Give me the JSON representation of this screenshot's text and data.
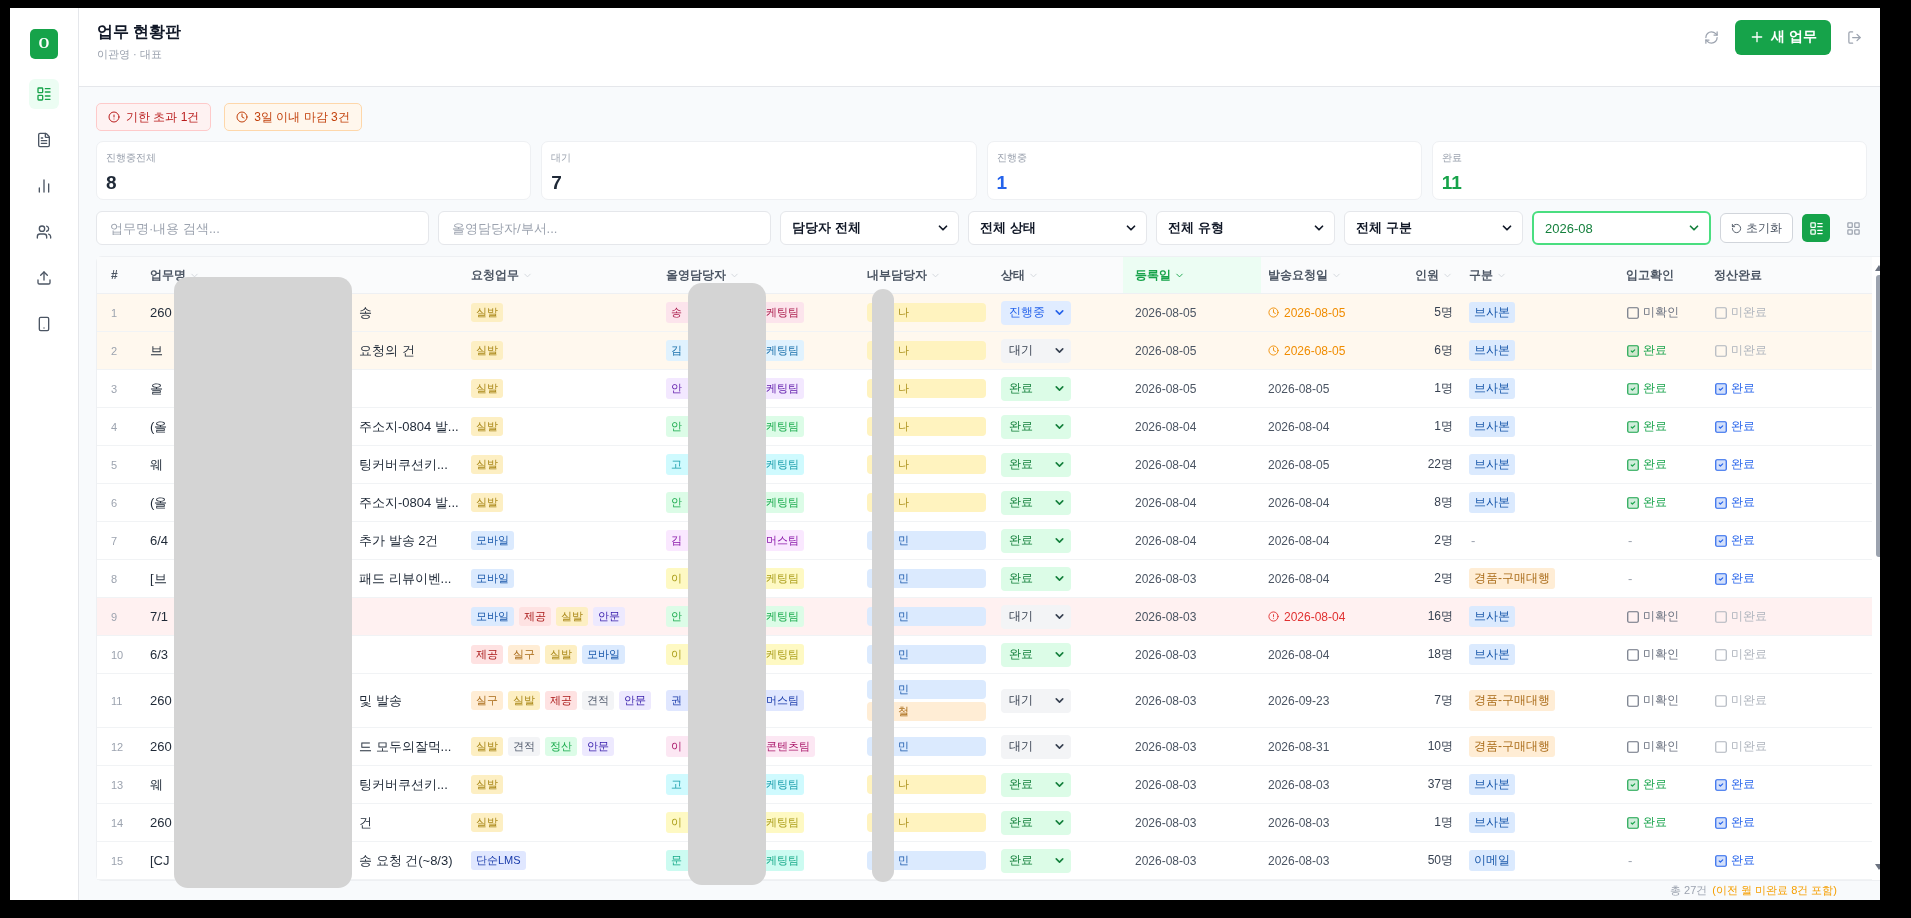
{
  "sidebar": {
    "logo": "O",
    "items": [
      {
        "kind": "list",
        "selected": true
      },
      {
        "kind": "document",
        "selected": false
      },
      {
        "kind": "chart",
        "selected": false
      },
      {
        "kind": "users",
        "selected": false
      },
      {
        "kind": "upload",
        "selected": false
      },
      {
        "kind": "phone",
        "selected": false
      }
    ]
  },
  "header": {
    "title": "업무 현황판",
    "subtitle": "이관영 · 대표",
    "new_button": "새 업무"
  },
  "alerts": [
    {
      "label": "기한 초과 1건",
      "kind": "overdue"
    },
    {
      "label": "3일 이내 마감 3건",
      "kind": "due_soon"
    }
  ],
  "stats": [
    {
      "label": "진행중전체",
      "value": "8",
      "color": "#1f2937"
    },
    {
      "label": "대기",
      "value": "7",
      "color": "#1f2937"
    },
    {
      "label": "진행중",
      "value": "1",
      "color": "#2563eb"
    },
    {
      "label": "완료",
      "value": "11",
      "color": "#16a34a"
    }
  ],
  "filters": {
    "searches": [
      {
        "placeholder": "업무명·내용 검색..."
      },
      {
        "placeholder": "올영담당자/부서..."
      }
    ],
    "selects": [
      {
        "value": "담당자 전체",
        "active": false
      },
      {
        "value": "전체 상태",
        "active": false
      },
      {
        "value": "전체 유형",
        "active": false
      },
      {
        "value": "전체 구분",
        "active": false
      },
      {
        "value": "2026-08",
        "active": true
      }
    ],
    "reset": "초기화",
    "views": [
      {
        "kind": "list",
        "selected": true
      },
      {
        "kind": "grid",
        "selected": false
      }
    ]
  },
  "table": {
    "columns": [
      {
        "label": "#",
        "sortable": false,
        "sorted": false
      },
      {
        "label": "업무명",
        "sortable": true,
        "sorted": false
      },
      {
        "label": "요청업무",
        "sortable": true,
        "sorted": false
      },
      {
        "label": "올영담당자",
        "sortable": true,
        "sorted": false
      },
      {
        "label": "내부담당자",
        "sortable": true,
        "sorted": false
      },
      {
        "label": "상태",
        "sortable": true,
        "sorted": false
      },
      {
        "label": "등록일",
        "sortable": true,
        "sorted": true
      },
      {
        "label": "발송요청일",
        "sortable": true,
        "sorted": false
      },
      {
        "label": "인원",
        "sortable": true,
        "sorted": false
      },
      {
        "label": "구분",
        "sortable": true,
        "sorted": false
      },
      {
        "label": "입고확인",
        "sortable": false,
        "sorted": false
      },
      {
        "label": "정산완료",
        "sortable": false,
        "sorted": false
      }
    ],
    "rows": [
      {
        "number": "1",
        "overdue": false,
        "due_soon": true,
        "name_head": "260",
        "name_tail": "송",
        "tasks": [
          {
            "label": "실발",
            "color": "#fdefc3"
          }
        ],
        "manager": {
          "head": "송",
          "tail": "케팅팀",
          "color": "#fce4ec"
        },
        "assignees": [
          {
            "label": "나",
            "color": "#fff3bf"
          }
        ],
        "status": {
          "label": "진행중",
          "kind": "progress"
        },
        "registered": "2026-08-05",
        "send_date": "2026-08-05",
        "people": "5명",
        "category": {
          "label": "브사본",
          "color": "#dbeafe"
        },
        "stock": {
          "kind": "check",
          "label": "미확인",
          "checked": false,
          "disabled": false
        },
        "settle": {
          "kind": "check",
          "label": "미완료",
          "checked": false,
          "disabled": true
        }
      },
      {
        "number": "2",
        "overdue": false,
        "due_soon": true,
        "name_head": "브",
        "name_tail": "요청의 건",
        "tasks": [
          {
            "label": "실발",
            "color": "#fdefc3"
          }
        ],
        "manager": {
          "head": "김",
          "tail": "케팅팀",
          "color": "#e0f2fe"
        },
        "assignees": [
          {
            "label": "나",
            "color": "#fff3bf"
          }
        ],
        "status": {
          "label": "대기",
          "kind": "waiting"
        },
        "registered": "2026-08-05",
        "send_date": "2026-08-05",
        "people": "6명",
        "category": {
          "label": "브사본",
          "color": "#dbeafe"
        },
        "stock": {
          "kind": "check",
          "label": "완료",
          "checked": true,
          "disabled": false
        },
        "settle": {
          "kind": "check",
          "label": "미완료",
          "checked": false,
          "disabled": true
        }
      },
      {
        "number": "3",
        "overdue": false,
        "due_soon": false,
        "name_head": "올",
        "tasks": [
          {
            "label": "실발",
            "color": "#fdefc3"
          }
        ],
        "manager": {
          "head": "안",
          "tail": "케팅팀",
          "color": "#f3e8ff"
        },
        "assignees": [
          {
            "label": "나",
            "color": "#fff3bf"
          }
        ],
        "status": {
          "label": "완료",
          "kind": "done"
        },
        "registered": "2026-08-05",
        "send_date": "2026-08-05",
        "people": "1명",
        "category": {
          "label": "브사본",
          "color": "#dbeafe"
        },
        "stock": {
          "kind": "check",
          "label": "완료",
          "checked": true,
          "disabled": false
        },
        "settle": {
          "kind": "check",
          "label": "완료",
          "checked": true,
          "disabled": false
        }
      },
      {
        "number": "4",
        "overdue": false,
        "due_soon": false,
        "name_head": "(올",
        "name_tail": "주소지-0804 발...",
        "tasks": [
          {
            "label": "실발",
            "color": "#fdefc3"
          }
        ],
        "manager": {
          "head": "안",
          "tail": "케팅팀",
          "color": "#dcfce7"
        },
        "assignees": [
          {
            "label": "나",
            "color": "#fff3bf"
          }
        ],
        "status": {
          "label": "완료",
          "kind": "done"
        },
        "registered": "2026-08-04",
        "send_date": "2026-08-04",
        "people": "1명",
        "category": {
          "label": "브사본",
          "color": "#dbeafe"
        },
        "stock": {
          "kind": "check",
          "label": "완료",
          "checked": true,
          "disabled": false
        },
        "settle": {
          "kind": "check",
          "label": "완료",
          "checked": true,
          "disabled": false
        }
      },
      {
        "number": "5",
        "overdue": false,
        "due_soon": false,
        "name_head": "웨",
        "name_tail": "팅커버쿠션키...",
        "tasks": [
          {
            "label": "실발",
            "color": "#fdefc3"
          }
        ],
        "manager": {
          "head": "고",
          "tail": "케팅팀",
          "color": "#cffafe"
        },
        "assignees": [
          {
            "label": "나",
            "color": "#fff3bf"
          }
        ],
        "status": {
          "label": "완료",
          "kind": "done"
        },
        "registered": "2026-08-04",
        "send_date": "2026-08-05",
        "people": "22명",
        "category": {
          "label": "브사본",
          "color": "#dbeafe"
        },
        "stock": {
          "kind": "check",
          "label": "완료",
          "checked": true,
          "disabled": false
        },
        "settle": {
          "kind": "check",
          "label": "완료",
          "checked": true,
          "disabled": false
        }
      },
      {
        "number": "6",
        "overdue": false,
        "due_soon": false,
        "name_head": "(올",
        "name_tail": "주소지-0804 발...",
        "tasks": [
          {
            "label": "실발",
            "color": "#fdefc3"
          }
        ],
        "manager": {
          "head": "안",
          "tail": "케팅팀",
          "color": "#dcfce7"
        },
        "assignees": [
          {
            "label": "나",
            "color": "#fff3bf"
          }
        ],
        "status": {
          "label": "완료",
          "kind": "done"
        },
        "registered": "2026-08-04",
        "send_date": "2026-08-04",
        "people": "8명",
        "category": {
          "label": "브사본",
          "color": "#dbeafe"
        },
        "stock": {
          "kind": "check",
          "label": "완료",
          "checked": true,
          "disabled": false
        },
        "settle": {
          "kind": "check",
          "label": "완료",
          "checked": true,
          "disabled": false
        }
      },
      {
        "number": "7",
        "overdue": false,
        "due_soon": false,
        "name_head": "6/4",
        "name_tail": "추가 발송 2건",
        "tasks": [
          {
            "label": "모바일",
            "color": "#dbeafe"
          }
        ],
        "manager": {
          "head": "김",
          "tail": "머스팀",
          "color": "#fae8ff"
        },
        "assignees": [
          {
            "label": "민",
            "color": "#dbeafe"
          }
        ],
        "status": {
          "label": "완료",
          "kind": "done"
        },
        "registered": "2026-08-04",
        "send_date": "2026-08-04",
        "people": "2명",
        "category": {
          "label": "-"
        },
        "stock": {
          "kind": "dash",
          "label": "-"
        },
        "settle": {
          "kind": "check",
          "label": "완료",
          "checked": true,
          "disabled": false
        }
      },
      {
        "number": "8",
        "overdue": false,
        "due_soon": false,
        "name_head": "[브",
        "name_tail": "패드 리뷰이벤...",
        "tasks": [
          {
            "label": "모바일",
            "color": "#dbeafe"
          }
        ],
        "manager": {
          "head": "이",
          "tail": "케팅팀",
          "color": "#fef9c3"
        },
        "assignees": [
          {
            "label": "민",
            "color": "#dbeafe"
          }
        ],
        "status": {
          "label": "완료",
          "kind": "done"
        },
        "registered": "2026-08-03",
        "send_date": "2026-08-04",
        "people": "2명",
        "category": {
          "label": "경품-구매대행",
          "color": "#ffedd5"
        },
        "stock": {
          "kind": "dash",
          "label": "-"
        },
        "settle": {
          "kind": "check",
          "label": "완료",
          "checked": true,
          "disabled": false
        }
      },
      {
        "number": "9",
        "overdue": true,
        "due_soon": false,
        "name_head": "7/1",
        "tasks": [
          {
            "label": "모바일",
            "color": "#dbeafe"
          },
          {
            "label": "제공",
            "color": "#fee2e2"
          },
          {
            "label": "실발",
            "color": "#fdefc3"
          },
          {
            "label": "안문",
            "color": "#ede9fe"
          }
        ],
        "manager": {
          "head": "안",
          "tail": "케팅팀",
          "color": "#dcfce7"
        },
        "assignees": [
          {
            "label": "민",
            "color": "#dbeafe"
          }
        ],
        "status": {
          "label": "대기",
          "kind": "waiting"
        },
        "registered": "2026-08-03",
        "send_date": "2026-08-04",
        "people": "16명",
        "category": {
          "label": "브사본",
          "color": "#dbeafe"
        },
        "stock": {
          "kind": "check",
          "label": "미확인",
          "checked": false,
          "disabled": false
        },
        "settle": {
          "kind": "check",
          "label": "미완료",
          "checked": false,
          "disabled": true
        }
      },
      {
        "number": "10",
        "overdue": false,
        "due_soon": false,
        "name_head": "6/3",
        "tasks": [
          {
            "label": "제공",
            "color": "#fee2e2"
          },
          {
            "label": "실구",
            "color": "#ffedd5"
          },
          {
            "label": "실발",
            "color": "#fdefc3"
          },
          {
            "label": "모바일",
            "color": "#dbeafe"
          }
        ],
        "manager": {
          "head": "이",
          "tail": "케팅팀",
          "color": "#fef9c3"
        },
        "assignees": [
          {
            "label": "민",
            "color": "#dbeafe"
          }
        ],
        "status": {
          "label": "완료",
          "kind": "done"
        },
        "registered": "2026-08-03",
        "send_date": "2026-08-04",
        "people": "18명",
        "category": {
          "label": "브사본",
          "color": "#dbeafe"
        },
        "stock": {
          "kind": "check",
          "label": "미확인",
          "checked": false,
          "disabled": false
        },
        "settle": {
          "kind": "check",
          "label": "미완료",
          "checked": false,
          "disabled": true
        }
      },
      {
        "number": "11",
        "overdue": false,
        "due_soon": false,
        "name_head": "260",
        "name_tail": "및 발송",
        "tasks": [
          {
            "label": "실구",
            "color": "#ffedd5"
          },
          {
            "label": "실발",
            "color": "#fdefc3"
          },
          {
            "label": "제공",
            "color": "#fee2e2"
          },
          {
            "label": "견적",
            "color": "#f3f4f6"
          },
          {
            "label": "안문",
            "color": "#ede9fe"
          }
        ],
        "manager": {
          "head": "권",
          "tail": "머스팀",
          "color": "#e0e7ff"
        },
        "assignees": [
          {
            "label": "민",
            "color": "#dbeafe"
          },
          {
            "label": "철",
            "color": "#ffedd5"
          }
        ],
        "status": {
          "label": "대기",
          "kind": "waiting"
        },
        "registered": "2026-08-03",
        "send_date": "2026-09-23",
        "people": "7명",
        "category": {
          "label": "경품-구매대행",
          "color": "#ffedd5"
        },
        "stock": {
          "kind": "check",
          "label": "미확인",
          "checked": false,
          "disabled": false
        },
        "settle": {
          "kind": "check",
          "label": "미완료",
          "checked": false,
          "disabled": true
        }
      },
      {
        "number": "12",
        "overdue": false,
        "due_soon": false,
        "name_head": "260",
        "name_tail": "드 모두의잘먹...",
        "tasks": [
          {
            "label": "실발",
            "color": "#fdefc3"
          },
          {
            "label": "견적",
            "color": "#f3f4f6"
          },
          {
            "label": "정산",
            "color": "#dcfce7"
          },
          {
            "label": "안문",
            "color": "#ede9fe"
          }
        ],
        "manager": {
          "head": "이",
          "tail": "콘텐츠팀",
          "color": "#fce7f3"
        },
        "assignees": [
          {
            "label": "민",
            "color": "#dbeafe"
          }
        ],
        "status": {
          "label": "대기",
          "kind": "waiting"
        },
        "registered": "2026-08-03",
        "send_date": "2026-08-31",
        "people": "10명",
        "category": {
          "label": "경품-구매대행",
          "color": "#ffedd5"
        },
        "stock": {
          "kind": "check",
          "label": "미확인",
          "checked": false,
          "disabled": false
        },
        "settle": {
          "kind": "check",
          "label": "미완료",
          "checked": false,
          "disabled": true
        }
      },
      {
        "number": "13",
        "overdue": false,
        "due_soon": false,
        "name_head": "웨",
        "name_tail": "팅커버쿠션키...",
        "tasks": [
          {
            "label": "실발",
            "color": "#fdefc3"
          }
        ],
        "manager": {
          "head": "고",
          "tail": "케팅팀",
          "color": "#cffafe"
        },
        "assignees": [
          {
            "label": "나",
            "color": "#fff3bf"
          }
        ],
        "status": {
          "label": "완료",
          "kind": "done"
        },
        "registered": "2026-08-03",
        "send_date": "2026-08-03",
        "people": "37명",
        "category": {
          "label": "브사본",
          "color": "#dbeafe"
        },
        "stock": {
          "kind": "check",
          "label": "완료",
          "checked": true,
          "disabled": false
        },
        "settle": {
          "kind": "check",
          "label": "완료",
          "checked": true,
          "disabled": false
        }
      },
      {
        "number": "14",
        "overdue": false,
        "due_soon": false,
        "name_head": "260",
        "name_tail": "건",
        "tasks": [
          {
            "label": "실발",
            "color": "#fdefc3"
          }
        ],
        "manager": {
          "head": "이",
          "tail": "케팅팀",
          "color": "#fef9c3"
        },
        "assignees": [
          {
            "label": "나",
            "color": "#fff3bf"
          }
        ],
        "status": {
          "label": "완료",
          "kind": "done"
        },
        "registered": "2026-08-03",
        "send_date": "2026-08-03",
        "people": "1명",
        "category": {
          "label": "브사본",
          "color": "#dbeafe"
        },
        "stock": {
          "kind": "check",
          "label": "완료",
          "checked": true,
          "disabled": false
        },
        "settle": {
          "kind": "check",
          "label": "완료",
          "checked": true,
          "disabled": false
        }
      },
      {
        "number": "15",
        "overdue": false,
        "due_soon": false,
        "name_head": "[CJ",
        "name_tail": "송 요청 건(~8/3)",
        "tasks": [
          {
            "label": "단순LMS",
            "color": "#e0e7ff"
          }
        ],
        "manager": {
          "head": "문",
          "tail": "케팅팀",
          "color": "#ccfbf1"
        },
        "assignees": [
          {
            "label": "민",
            "color": "#dbeafe"
          }
        ],
        "status": {
          "label": "완료",
          "kind": "done"
        },
        "registered": "2026-08-03",
        "send_date": "2026-08-03",
        "people": "50명",
        "category": {
          "label": "이메일",
          "color": "#dbeafe"
        },
        "stock": {
          "kind": "dash",
          "label": "-"
        },
        "settle": {
          "kind": "check",
          "label": "완료",
          "checked": true,
          "disabled": false
        }
      }
    ]
  },
  "footer": {
    "total": "총 27건",
    "note": "(이전 월 미완료 8건 포함)"
  }
}
